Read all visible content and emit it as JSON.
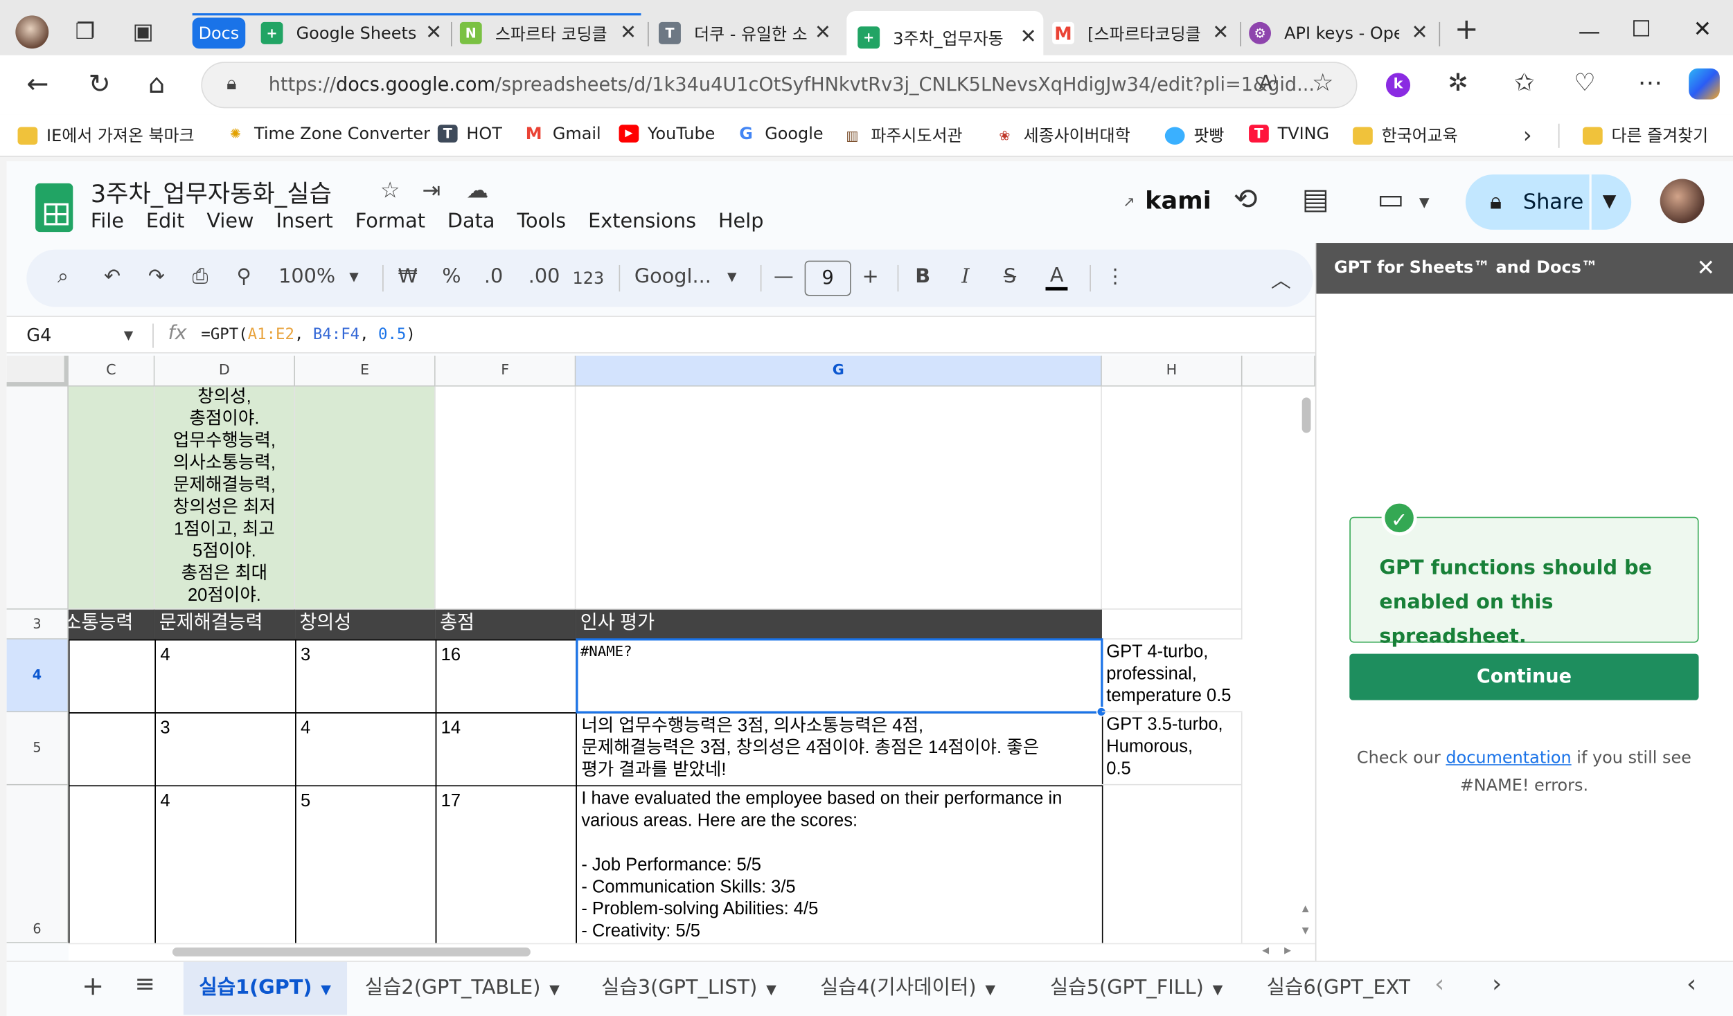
{
  "browser": {
    "tabs": [
      {
        "label": "Docs",
        "group": true
      },
      {
        "label": "Google Sheets"
      },
      {
        "label": "스파르타 코딩클"
      },
      {
        "label": "더쿠 - 유일한 소"
      },
      {
        "label": "3주차_업무자동",
        "active": true
      },
      {
        "label": "[스파르타코딩클"
      },
      {
        "label": "API keys - Oper"
      }
    ],
    "url": {
      "scheme": "https://",
      "host": "docs.google.com",
      "path": "/spreadsheets/d/1k34u4U1cOtSyfHNkvtRv3j_CNLK5LNevsXqHdigJw34/edit?pli=1&gid..."
    },
    "bookmarks": [
      {
        "label": "IE에서 가져온 북마크",
        "icon": "folder-icon"
      },
      {
        "label": "Time Zone Converter",
        "icon": "timezone-icon"
      },
      {
        "label": "HOT",
        "icon": "theqoo-icon"
      },
      {
        "label": "Gmail",
        "icon": "gmail-icon"
      },
      {
        "label": "YouTube",
        "icon": "youtube-icon"
      },
      {
        "label": "Google",
        "icon": "google-icon"
      },
      {
        "label": "파주시도서관",
        "icon": "library-icon"
      },
      {
        "label": "세종사이버대학",
        "icon": "sejong-icon"
      },
      {
        "label": "팟빵",
        "icon": "podbbang-icon"
      },
      {
        "label": "TVING",
        "icon": "tving-icon"
      },
      {
        "label": "한국어교육",
        "icon": "folder-icon"
      },
      {
        "label": "다른 즐겨찾기",
        "icon": "folder-icon"
      }
    ]
  },
  "sheets": {
    "title": "3주차_업무자동화_실습",
    "menu": [
      "File",
      "Edit",
      "View",
      "Insert",
      "Format",
      "Data",
      "Tools",
      "Extensions",
      "Help"
    ],
    "kami": "kami",
    "share": "Share",
    "toolbar": {
      "zoom": "100%",
      "currency": "₩",
      "percent": "%",
      "dec_decrease": ".0",
      "dec_increase": ".00",
      "number_format": "123",
      "font": "Googl...",
      "font_size": "9"
    },
    "namebox": "G4",
    "formula": {
      "prefix": "=GPT(",
      "range1": "A1:E2",
      "sep1": ", ",
      "range2": "B4:F4",
      "sep2": ", ",
      "num": "0.5",
      "suffix": ")"
    },
    "columns": [
      "C",
      "D",
      "E",
      "F",
      "G",
      "H"
    ],
    "rows": [
      "3",
      "4",
      "5",
      "6"
    ],
    "prompt_text": "창의성,\n총점이야.\n업무수행능력,\n의사소통능력,\n문제해결능력,\n창의성은 최저\n1점이고, 최고\n5점이야.\n총점은 최대\n20점이야.",
    "headers": {
      "c": "소통능력",
      "d": "문제해결능력",
      "e": "창의성",
      "f": "총점",
      "g": "인사 평가"
    },
    "row4": {
      "d": "4",
      "e": "3",
      "f": "16",
      "g": "#NAME?",
      "h": "GPT 4-turbo,\nprofessinal,\ntemperature 0.5"
    },
    "row5": {
      "d": "3",
      "e": "4",
      "f": "14",
      "g": "너의 업무수행능력은 3점, 의사소통능력은 4점,\n문제해결능력은 3점, 창의성은 4점이야. 총점은 14점이야. 좋은\n평가 결과를 받았네!",
      "h": "GPT 3.5-turbo,\nHumorous,\n0.5"
    },
    "row6": {
      "d": "4",
      "e": "5",
      "f": "17",
      "g": "I have evaluated the employee based on their performance in\nvarious areas. Here are the scores:\n\n- Job Performance: 5/5\n- Communication Skills: 3/5\n- Problem-solving Abilities: 4/5\n- Creativity: 5/5"
    },
    "sheet_tabs": [
      "실습1(GPT)",
      "실습2(GPT_TABLE)",
      "실습3(GPT_LIST)",
      "실습4(기사데이터)",
      "실습5(GPT_FILL)",
      "실습6(GPT_EXT"
    ]
  },
  "panel": {
    "title": "GPT for Sheets™ and Docs™",
    "notice": "GPT functions should be enabled on this spreadsheet.",
    "continue": "Continue",
    "foot_pre": "Check our ",
    "foot_link": "documentation",
    "foot_post": " if you still see #NAME! errors."
  }
}
